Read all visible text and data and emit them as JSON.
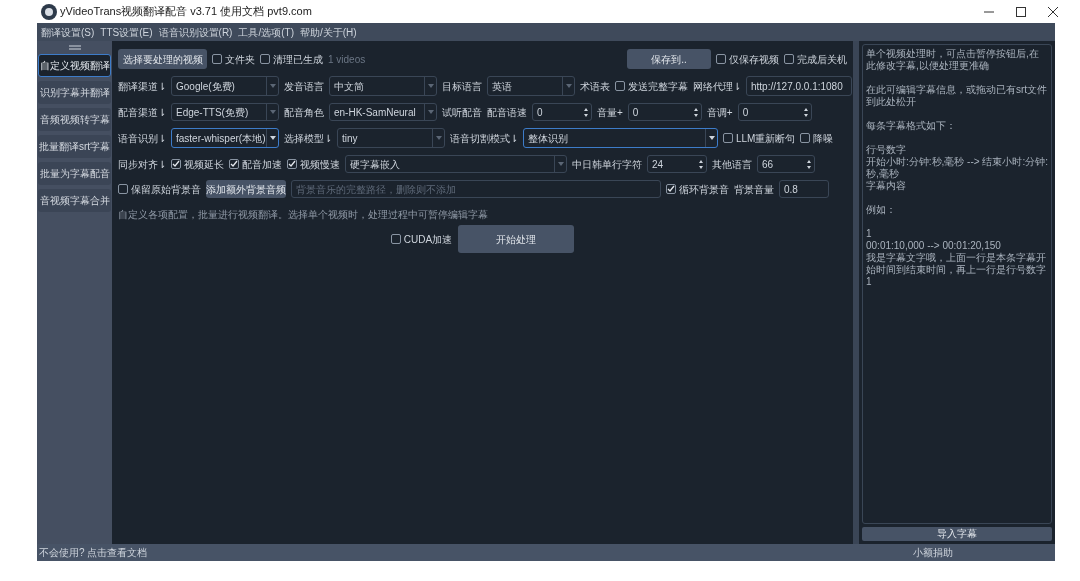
{
  "window": {
    "title": "yVideoTrans视频翻译配音 v3.71  使用文档  pvt9.com"
  },
  "menu": [
    "翻译设置(S)",
    "TTS设置(E)",
    "语音识别设置(R)",
    "工具/选项(T)",
    "帮助/关于(H)"
  ],
  "sidebar": {
    "items": [
      {
        "label": "自定义视频翻译",
        "selected": true
      },
      {
        "label": "识别字幕并翻译",
        "selected": false
      },
      {
        "label": "音频视频转字幕",
        "selected": false
      },
      {
        "label": "批量翻译srt字幕",
        "selected": false
      },
      {
        "label": "批量为字幕配音",
        "selected": false
      },
      {
        "label": "音视频字幕合并",
        "selected": false
      }
    ]
  },
  "rows": [
    [
      {
        "kind": "button",
        "text": "选择要处理的视频"
      },
      {
        "kind": "checkbox",
        "text": "文件夹",
        "checked": false
      },
      {
        "kind": "checkbox",
        "text": "清理已生成",
        "checked": false
      },
      {
        "kind": "note",
        "text": "1 videos"
      },
      {
        "kind": "spacer"
      },
      {
        "kind": "button",
        "text": "保存到.."
      },
      {
        "kind": "checkbox",
        "text": "仅保存视频",
        "checked": false
      },
      {
        "kind": "checkbox",
        "text": "完成后关机",
        "checked": false
      }
    ],
    [
      {
        "kind": "label",
        "text": "翻译渠道⇂"
      },
      {
        "kind": "select",
        "value": "Google(免费)",
        "focused": false
      },
      {
        "kind": "label",
        "text": "发音语言"
      },
      {
        "kind": "select",
        "value": "中文简",
        "focused": false
      },
      {
        "kind": "label",
        "text": "目标语言"
      },
      {
        "kind": "select",
        "value": "英语",
        "focused": false
      },
      {
        "kind": "label",
        "text": "术语表"
      },
      {
        "kind": "checkbox",
        "text": "发送完整字幕",
        "checked": false
      },
      {
        "kind": "label",
        "text": "网络代理⇂"
      },
      {
        "kind": "input",
        "value": "http://127.0.0.1:1080"
      }
    ],
    [
      {
        "kind": "label",
        "text": "配音渠道⇂"
      },
      {
        "kind": "select",
        "value": "Edge-TTS(免费)",
        "focused": false
      },
      {
        "kind": "label",
        "text": "配音角色"
      },
      {
        "kind": "select",
        "value": "en-HK-SamNeural",
        "focused": false
      },
      {
        "kind": "label",
        "text": "试听配音"
      },
      {
        "kind": "label",
        "text": "配音语速"
      },
      {
        "kind": "spin",
        "value": "0"
      },
      {
        "kind": "label",
        "text": "音量+"
      },
      {
        "kind": "spin",
        "value": "0"
      },
      {
        "kind": "label",
        "text": "音调+"
      },
      {
        "kind": "spin",
        "value": "0"
      }
    ],
    [
      {
        "kind": "label",
        "text": "语音识别⇂"
      },
      {
        "kind": "select",
        "value": "faster-whisper(本地)",
        "focused": true
      },
      {
        "kind": "label",
        "text": "选择模型⇂"
      },
      {
        "kind": "select",
        "value": "tiny",
        "focused": false
      },
      {
        "kind": "label",
        "text": "语音切割模式⇂"
      },
      {
        "kind": "select",
        "value": "整体识别",
        "focused": true
      },
      {
        "kind": "checkbox",
        "text": "LLM重新断句",
        "checked": false
      },
      {
        "kind": "checkbox",
        "text": "降噪",
        "checked": false
      }
    ],
    [
      {
        "kind": "label",
        "text": "同步对齐⇂"
      },
      {
        "kind": "checkbox",
        "text": "视频延长",
        "checked": true
      },
      {
        "kind": "checkbox",
        "text": "配音加速",
        "checked": true
      },
      {
        "kind": "checkbox",
        "text": "视频慢速",
        "checked": true
      },
      {
        "kind": "select",
        "value": "硬字幕嵌入",
        "focused": false
      },
      {
        "kind": "label",
        "text": "中日韩单行字符"
      },
      {
        "kind": "spin",
        "value": "24"
      },
      {
        "kind": "label",
        "text": "其他语言"
      },
      {
        "kind": "spin",
        "value": "66"
      }
    ],
    [
      {
        "kind": "checkbox",
        "text": "保留原始背景音",
        "checked": false
      },
      {
        "kind": "button",
        "text": "添加额外背景音频"
      },
      {
        "kind": "input",
        "placeholder": "背景音乐的完整路径，删除则不添加"
      },
      {
        "kind": "checkbox",
        "text": "循环背景音",
        "checked": true
      },
      {
        "kind": "label",
        "text": "背景音量"
      },
      {
        "kind": "input",
        "value": "0.8"
      }
    ]
  ],
  "description": "自定义各项配置，批量进行视频翻译。选择单个视频时，处理过程中可暂停编辑字幕",
  "cuda": {
    "text": "CUDA加速",
    "checked": false
  },
  "start_button": "开始处理",
  "subtitle_editor": {
    "paragraphs": [
      [
        "单个视频处理时，可点击暂停按钮后,在此修改字幕,以便处理更准确"
      ],
      [
        "在此可编辑字幕信息，或拖动已有srt文件到此处松开"
      ],
      [
        "每条字幕格式如下："
      ],
      [
        "行号数字",
        "开始小时:分钟:秒,毫秒 --> 结束小时:分钟:秒,毫秒",
        "字幕内容"
      ],
      [
        "例如："
      ],
      [
        "1",
        "00:01:10,000 --> 00:01:20,150",
        "我是字幕文字哦，上面一行是本条字幕开始时间到结束时间，再上一行是行号数字1"
      ]
    ]
  },
  "import_button": "导入字幕",
  "status_bar": {
    "left": "不会使用? 点击查看文档",
    "right": "小额捐助"
  }
}
